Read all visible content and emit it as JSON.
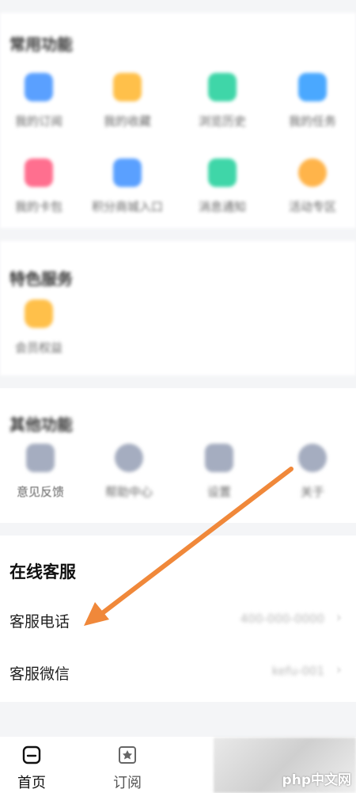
{
  "common_functions": {
    "title": "常用功能",
    "items": [
      {
        "label": "我的订阅",
        "icon": "note-icon",
        "color": "#5aa0ff"
      },
      {
        "label": "我的收藏",
        "icon": "star-icon",
        "color": "#ffc04a"
      },
      {
        "label": "浏览历史",
        "icon": "history-icon",
        "color": "#3fd6a8"
      },
      {
        "label": "我的任务",
        "icon": "task-icon",
        "color": "#4aa8ff"
      },
      {
        "label": "我的卡包",
        "icon": "card-icon",
        "color": "#ff6f8f"
      },
      {
        "label": "积分商城入口",
        "icon": "shop-icon",
        "color": "#5aa0ff"
      },
      {
        "label": "消息通知",
        "icon": "message-icon",
        "color": "#3fd6a8"
      },
      {
        "label": "活动专区",
        "icon": "gift-icon",
        "color": "#ffb44a"
      }
    ]
  },
  "special_services": {
    "title": "特色服务",
    "items": [
      {
        "label": "会员权益",
        "icon": "diamond-icon",
        "color": "#ffc04a"
      }
    ]
  },
  "other_functions": {
    "title": "其他功能",
    "items": [
      {
        "label": "意见反馈",
        "icon": "feedback-icon",
        "color": "#9aa3b8"
      },
      {
        "label": "帮助中心",
        "icon": "help-icon",
        "color": "#9aa3b8"
      },
      {
        "label": "设置",
        "icon": "settings-icon",
        "color": "#9aa3b8"
      },
      {
        "label": "关于",
        "icon": "about-icon",
        "color": "#9aa3b8"
      }
    ]
  },
  "online_service": {
    "title": "在线客服",
    "rows": [
      {
        "label": "客服电话",
        "value": "400-000-0000"
      },
      {
        "label": "客服微信",
        "value": "kefu-001"
      }
    ]
  },
  "tabbar": {
    "tabs": [
      {
        "label": "首页",
        "icon": "home-icon"
      },
      {
        "label": "订阅",
        "icon": "subscribe-icon"
      }
    ]
  },
  "watermark": {
    "text": "php中文网"
  },
  "colors": {
    "arrow": "#f0883a"
  }
}
